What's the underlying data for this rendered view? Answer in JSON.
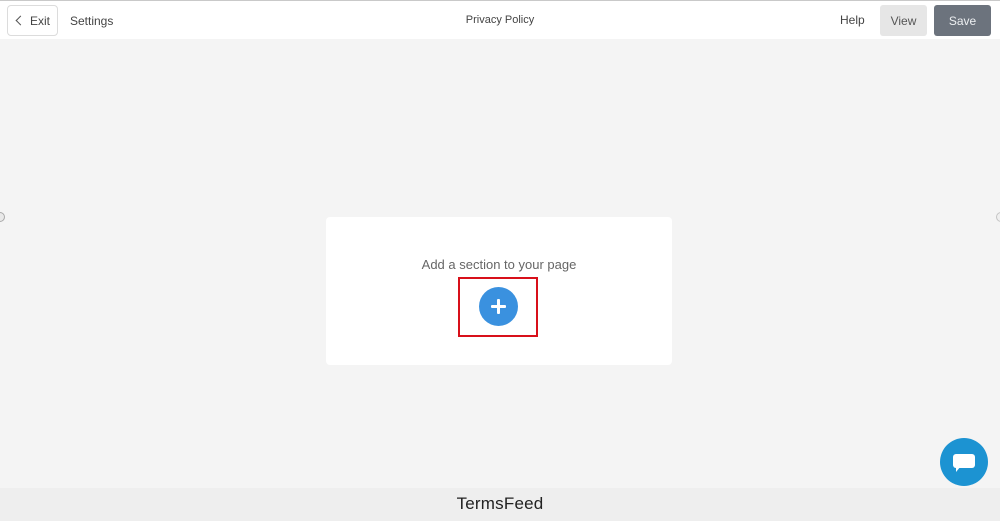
{
  "header": {
    "exit_label": "Exit",
    "settings_label": "Settings",
    "title": "Privacy Policy",
    "help_label": "Help",
    "view_label": "View",
    "save_label": "Save"
  },
  "main": {
    "empty_state_text": "Add a section to your page",
    "add_icon": "plus-icon"
  },
  "chat": {
    "icon": "chat-bubble-icon"
  },
  "footer": {
    "brand": "TermsFeed"
  },
  "colors": {
    "accent": "#3a91df",
    "highlight": "#d8101a",
    "save_button": "#6c737d",
    "chat_button": "#1c93d2"
  }
}
